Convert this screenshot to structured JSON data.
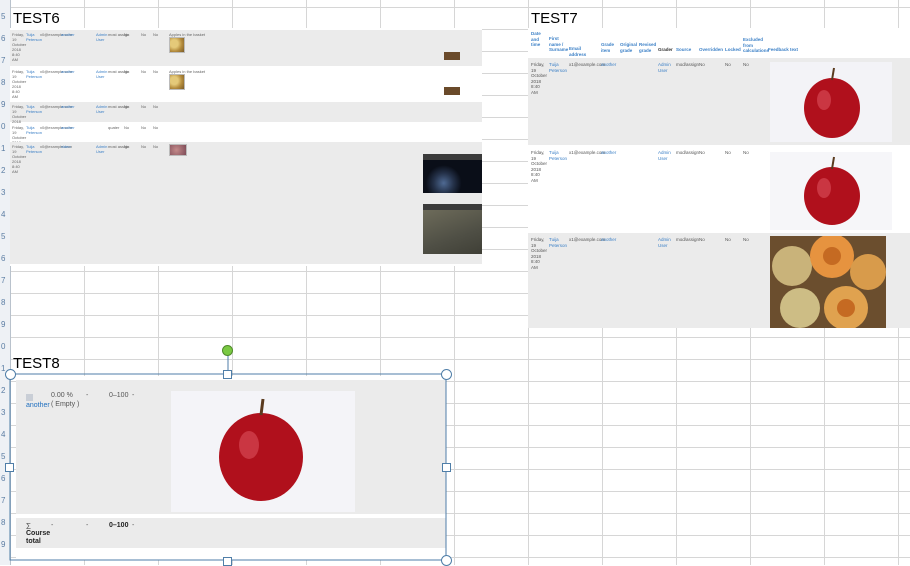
{
  "sheet": {
    "row_numbers": [
      "5",
      "6",
      "7",
      "8",
      "9",
      "0",
      "1",
      "2",
      "3",
      "4",
      "5",
      "6",
      "7",
      "8",
      "9",
      "0",
      "1",
      "2",
      "3",
      "4",
      "5",
      "6",
      "7",
      "8",
      "9"
    ]
  },
  "test6": {
    "title": "TEST6",
    "rows": [
      {
        "date": "Friday, 19 October 2018 8:40 AM",
        "name": "Tuija Peterson",
        "email": "x0@example.com",
        "assignment": "another",
        "user": "Admin User",
        "grader": "most assign",
        "ov": "No",
        "lock": "No",
        "ex": "No",
        "feedback": "Apples in the basket"
      },
      {
        "date": "Friday, 19 October 2018 8:40 AM",
        "name": "Tuija Peterson",
        "email": "x0@example.com",
        "assignment": "another",
        "user": "Admin User",
        "grader": "most assign",
        "ov": "No",
        "lock": "No",
        "ex": "No",
        "feedback": "Apples in the basket"
      },
      {
        "date": "Friday, 19 October 2018 8:40 AM",
        "name": "Tuija Peterson",
        "email": "x0@example.com",
        "assignment": "another",
        "user": "Admin User",
        "grader": "most assign",
        "ov": "No",
        "lock": "No",
        "ex": "No",
        "feedback": ""
      },
      {
        "date": "Friday, 19 October 2018 8:40 AM",
        "name": "Tuija Peterson",
        "email": "x0@example.com",
        "assignment": "another",
        "user": "",
        "grader": "quater",
        "ov": "No",
        "lock": "No",
        "ex": "No",
        "feedback": ""
      },
      {
        "date": "Friday, 19 October 2018 8:40 AM",
        "name": "Tuija Peterson",
        "email": "x0@example.com",
        "assignment": "video",
        "user": "Admin User",
        "grader": "most assign",
        "ov": "No",
        "lock": "No",
        "ex": "No",
        "feedback": ""
      }
    ]
  },
  "test7": {
    "title": "TEST7",
    "headers": [
      "Date and time",
      "First name / Surname",
      "Email address",
      "Grade item",
      "Original grade",
      "Revised grade",
      "Grader",
      "Source",
      "Overridden",
      "Locked",
      "Excluded from calculations",
      "Feedback text"
    ],
    "rows": [
      {
        "date": "Friday, 19 October 2018 8:40 AM",
        "name": "Tuija Peterson",
        "email": "x1@example.com",
        "item": "another",
        "grader": "Admin User",
        "source": "mod/assign",
        "overridden": "No",
        "locked": "No",
        "excluded": "No"
      },
      {
        "date": "Friday, 19 October 2018 8:40 AM",
        "name": "Tuija Peterson",
        "email": "x1@example.com",
        "item": "another",
        "grader": "Admin User",
        "source": "mod/assign",
        "overridden": "No",
        "locked": "No",
        "excluded": "No"
      },
      {
        "date": "Friday, 19 October 2018 8:40 AM",
        "name": "Tuija Peterson",
        "email": "x1@example.com",
        "item": "another",
        "grader": "Admin User",
        "source": "mod/assign",
        "overridden": "No",
        "locked": "No",
        "excluded": "No"
      }
    ]
  },
  "test8": {
    "title": "TEST8",
    "item_link": "another",
    "percentage": "0.00 %",
    "empty_label": "( Empty )",
    "dash": "-",
    "range": "0–100",
    "total_label_1": "Course",
    "total_label_2": "total",
    "total_dash_1": "-",
    "total_dash_2": "-",
    "total_range": "0–100",
    "total_dash_3": "-"
  },
  "colors": {
    "link": "#1f6fbf",
    "row_grey": "#ebebeb",
    "selection": "#4f7ea8",
    "rotate_handle": "#7ac943"
  }
}
